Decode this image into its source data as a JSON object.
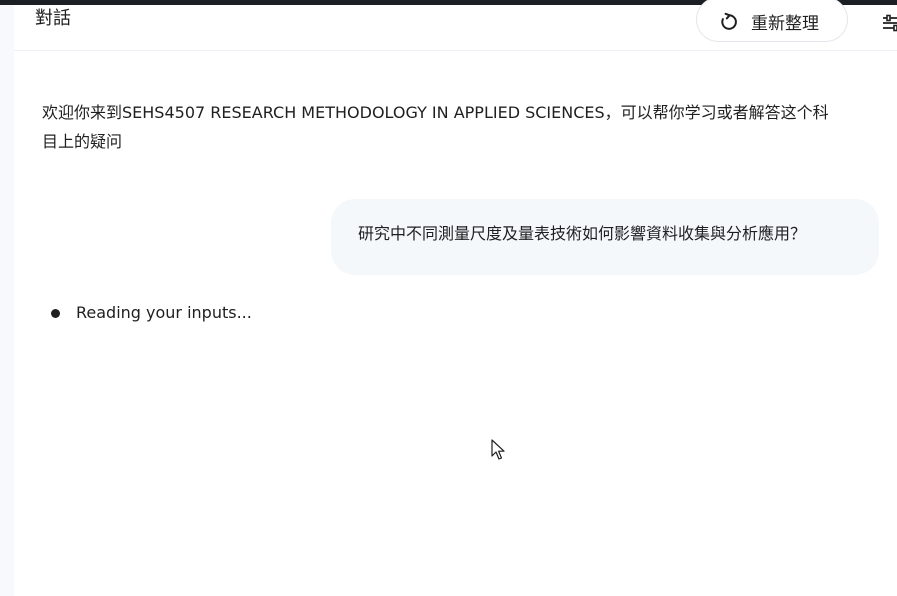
{
  "header": {
    "title": "對話",
    "refresh_label": "重新整理",
    "refresh_icon": "refresh-icon",
    "tune_icon": "tune-icon"
  },
  "conversation": {
    "welcome_message": "欢迎你来到SEHS4507 RESEARCH METHODOLOGY IN APPLIED SCIENCES，可以帮你学习或者解答这个科目上的疑问",
    "user_message": "研究中不同測量尺度及量表技術如何影響資料收集與分析應用？",
    "status_text": "Reading your inputs..."
  },
  "colors": {
    "top_strip": "#1c1f24",
    "bubble_bg": "#f5f8fb",
    "text": "#1f1f1f"
  }
}
